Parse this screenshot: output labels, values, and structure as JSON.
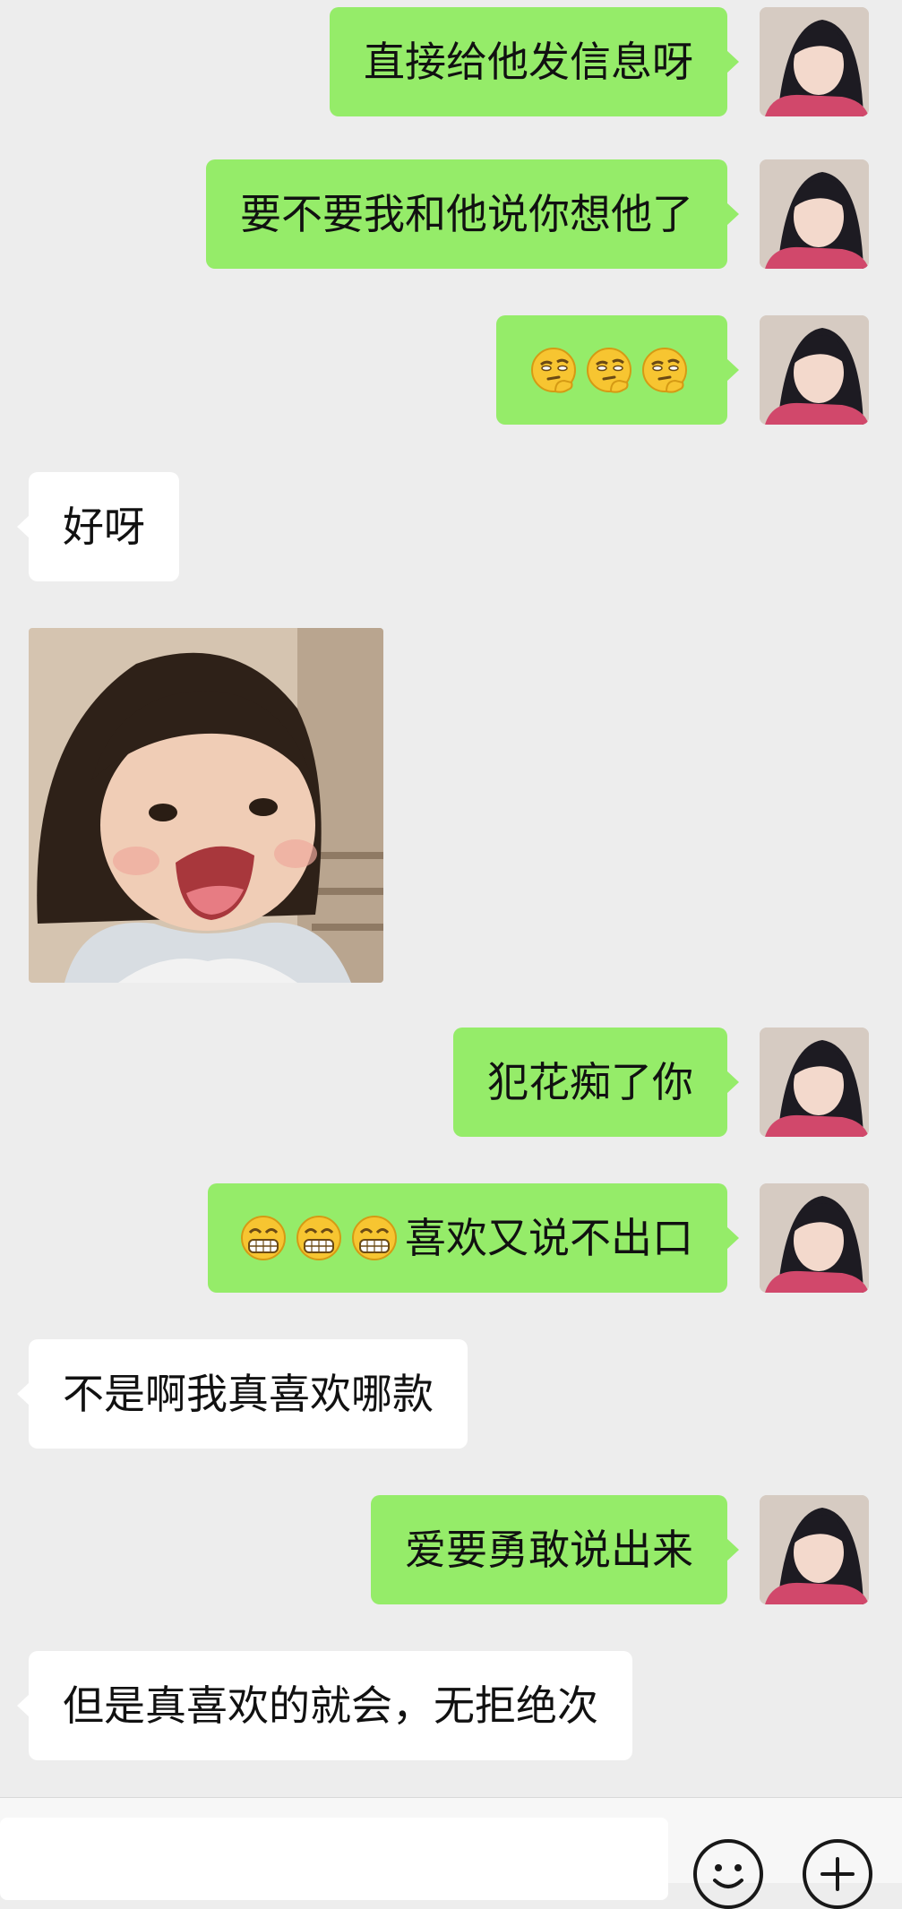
{
  "chat": {
    "messages": [
      {
        "direction": "out",
        "text": "直接给他发信息呀",
        "emoji_count": 0,
        "emoji_kind": ""
      },
      {
        "direction": "out",
        "text": "要不要我和他说你想他了",
        "emoji_count": 0,
        "emoji_kind": ""
      },
      {
        "direction": "out",
        "text": "",
        "emoji_count": 3,
        "emoji_kind": "thinking-face-emoji"
      },
      {
        "direction": "in",
        "text": "好呀",
        "emoji_count": 0,
        "emoji_kind": ""
      },
      {
        "direction": "in",
        "sticker": "laughing-girl-sticker"
      },
      {
        "direction": "out",
        "text": "犯花痴了你",
        "emoji_count": 0,
        "emoji_kind": ""
      },
      {
        "direction": "out",
        "text": "喜欢又说不出口",
        "emoji_count": 3,
        "emoji_kind": "grinning-face-emoji"
      },
      {
        "direction": "in",
        "text": "不是啊我真喜欢哪款",
        "emoji_count": 0,
        "emoji_kind": ""
      },
      {
        "direction": "out",
        "text": "爱要勇敢说出来",
        "emoji_count": 0,
        "emoji_kind": ""
      },
      {
        "direction": "in",
        "text": "但是真喜欢的就会，无拒绝次",
        "emoji_count": 0,
        "emoji_kind": ""
      }
    ]
  },
  "colors": {
    "background": "#ededed",
    "outgoing_bubble": "#95ec69",
    "incoming_bubble": "#ffffff",
    "input_bar": "#f7f7f7"
  },
  "input_bar": {
    "text_value": "",
    "emoji_button_icon": "smiley-face-icon",
    "more_button_icon": "plus-circle-icon"
  }
}
